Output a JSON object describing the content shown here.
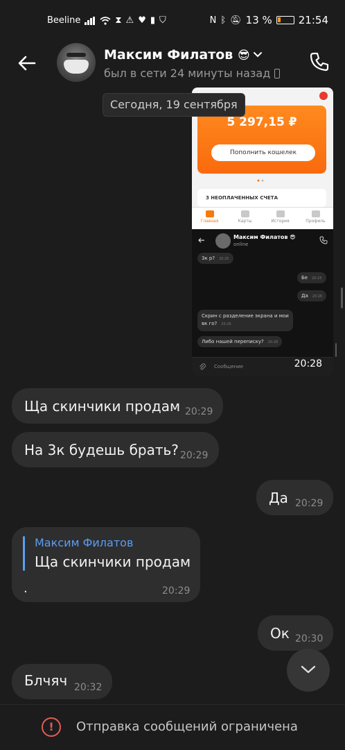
{
  "status_bar": {
    "carrier": "Beeline",
    "battery_percent": "13 %",
    "time": "21:54",
    "icons": [
      "signal-icon",
      "wifi-icon",
      "hourglass-icon",
      "warning-icon",
      "heart-rate-icon",
      "sim-icon",
      "shield-icon",
      "nfc-icon",
      "bluetooth-icon",
      "mute-icon",
      "battery-icon"
    ]
  },
  "header": {
    "contact_name": "Максим Филатов",
    "contact_emoji": "😎",
    "last_seen": "был в сети 24 минуты назад"
  },
  "date_separator": "Сегодня, 19 сентября",
  "screenshot_message": {
    "time": "20:28",
    "inner_app": {
      "balance": "5 297,15 ₽",
      "topup_button": "Пополнить кошелек",
      "unpaid_bills": "3 НЕОПЛАЧЕННЫХ СЧЕТА",
      "tabs": [
        "Главная",
        "Карты",
        "История",
        "Профиль"
      ]
    },
    "inner_chat": {
      "contact_name": "Максим Филатов",
      "contact_emoji": "😎",
      "status": "online",
      "messages": [
        {
          "text": "3к р?",
          "time": "20:25",
          "side": "left"
        },
        {
          "text": "Бе",
          "time": "20:25",
          "side": "right"
        },
        {
          "text": "Да",
          "time": "20:26",
          "side": "right"
        },
        {
          "text": "Скрин с разделение экрана и мои вк го?",
          "time": "20:26",
          "side": "left"
        },
        {
          "text": "Либо нашей переписку?",
          "time": "20:28",
          "side": "left"
        }
      ],
      "input_placeholder": "Сообщение"
    }
  },
  "messages": [
    {
      "text": "Ща скинчики продам",
      "time": "20:29",
      "side": "left"
    },
    {
      "text": "На 3к будешь брать?",
      "time": "20:29",
      "side": "left"
    },
    {
      "text": "Да",
      "time": "20:29",
      "side": "right"
    },
    {
      "text": "Ок",
      "time": "20:30",
      "side": "right"
    },
    {
      "text": "Блчяч",
      "time": "20:32",
      "side": "left"
    }
  ],
  "reply_message": {
    "quoted_author": "Максим Филатов",
    "quoted_text": "Ща скинчики продам",
    "text": ".",
    "time": "20:29"
  },
  "bottom_bar": {
    "notice": "Отправка сообщений ограничена"
  },
  "colors": {
    "background": "#1c1c1d",
    "bubble": "#2e2e2f",
    "accent_blue": "#5b9ef0",
    "warning_red": "#e05d56",
    "wallet_orange": "#f96a0d"
  }
}
